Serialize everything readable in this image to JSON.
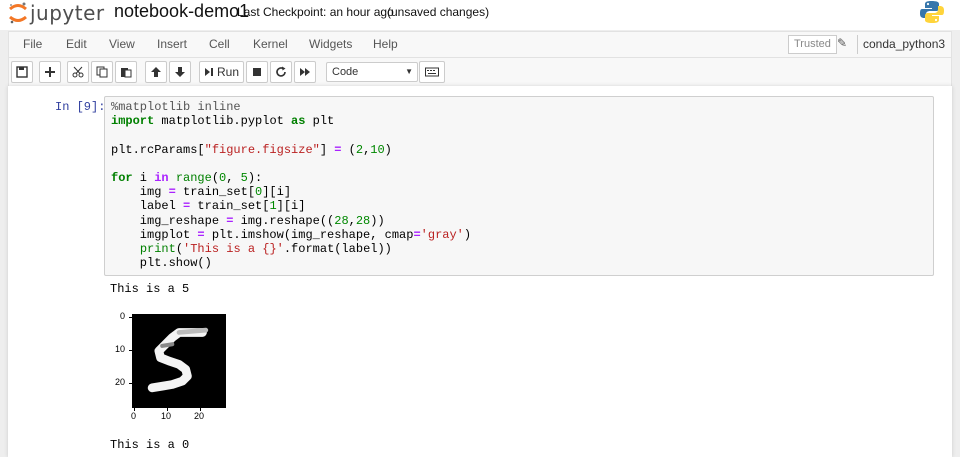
{
  "header": {
    "logo_text": "jupyter",
    "notebook_name": "notebook-demo1",
    "checkpoint": "Last Checkpoint: an hour ago",
    "status": "(unsaved changes)"
  },
  "menu": {
    "items": [
      "File",
      "Edit",
      "View",
      "Insert",
      "Cell",
      "Kernel",
      "Widgets",
      "Help"
    ],
    "trusted": "Trusted",
    "kernel": "conda_python3"
  },
  "toolbar": {
    "run_label": "Run",
    "cell_type": "Code"
  },
  "cell": {
    "prompt": "In [9]:",
    "code_lines": [
      "%matplotlib inline",
      "import matplotlib.pyplot as plt",
      "",
      "plt.rcParams[\"figure.figsize\"] = (2,10)",
      "",
      "for i in range(0, 5):",
      "    img = train_set[0][i]",
      "    label = train_set[1][i]",
      "    img_reshape = img.reshape((28,28))",
      "    imgplot = plt.imshow(img_reshape, cmap='gray')",
      "    print('This is a {}'.format(label))",
      "    plt.show()"
    ]
  },
  "output": {
    "line1": "This is a 5",
    "line2": "This is a 0",
    "plot": {
      "y_ticks": [
        "0",
        "10",
        "20"
      ],
      "x_ticks": [
        "0",
        "10",
        "20"
      ],
      "colormap": "gray",
      "background_color": "#000000",
      "digit_color": "#ffffff"
    }
  }
}
